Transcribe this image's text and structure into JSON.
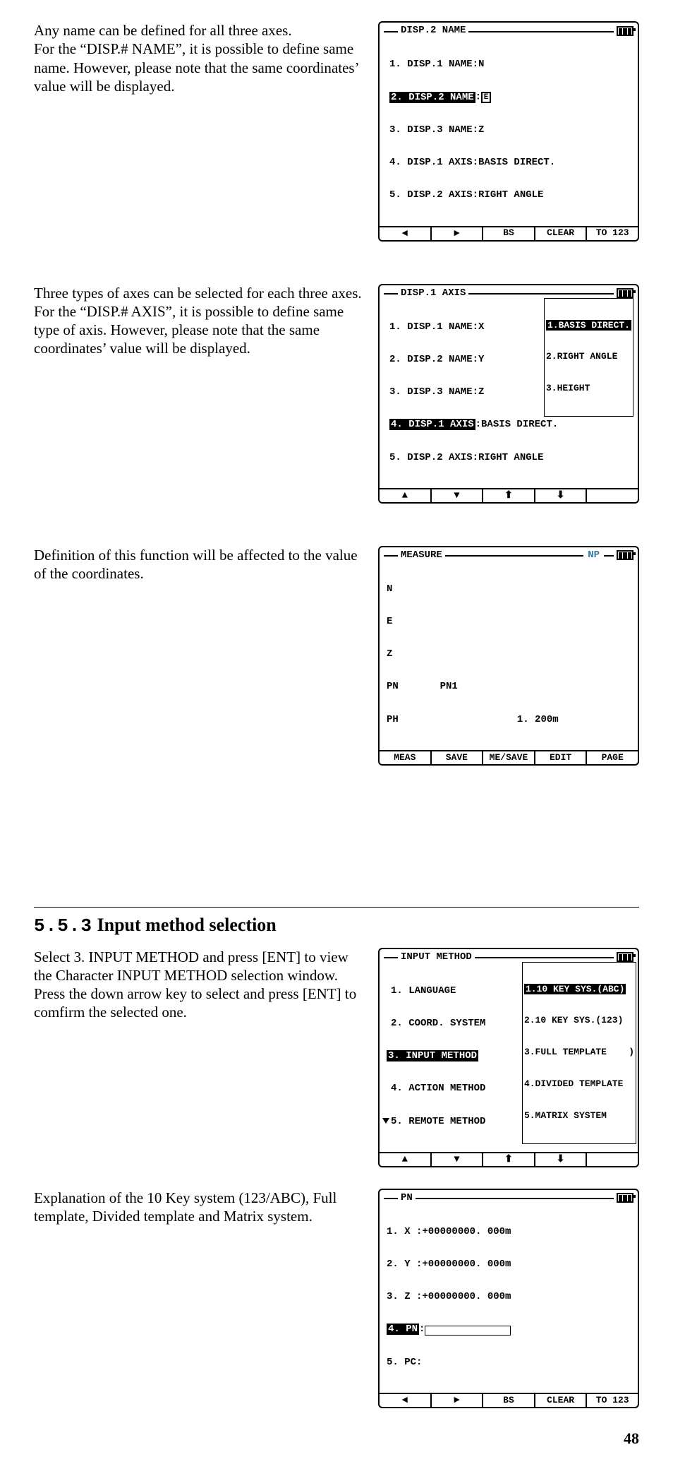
{
  "para1": "Any name can be defined for all three axes.\nFor the “DISP.# NAME”, it is possible to define same name. However, please note that the same coordinates’ value will be displayed.",
  "para2": "Three types of axes can be selected for each three axes.\nFor the “DISP.# AXIS”, it is possible to define same type of axis. However, please note that the same coordinates’ value will be displayed.",
  "para3": "Definition of this function will be affected to the value of the coordinates.",
  "section_number": "5.5.3",
  "section_title": "Input method selection",
  "para4": "Select 3. INPUT METHOD and press [ENT] to view the Character INPUT METHOD selection window. Press the down arrow key to select and press [ENT] to comfirm the selected one.",
  "para5": "Explanation of the 10 Key system (123/ABC), Full template, Divided template and Matrix system.",
  "page_number": "48",
  "lcd1": {
    "title": "DISP.2 NAME",
    "l1": "1. DISP.1 NAME:N",
    "l2a": "2. DISP.2 NAME",
    "l2b": "E",
    "l3": "3. DISP.3 NAME:Z",
    "l4": "4. DISP.1 AXIS:BASIS DIRECT.",
    "l5": "5. DISP.2 AXIS:RIGHT ANGLE",
    "sk3": "BS",
    "sk4": "CLEAR",
    "sk5": "TO 123"
  },
  "lcd2": {
    "title": "DISP.1 AXIS",
    "l1": "1. DISP.1 NAME:X",
    "l2": "2. DISP.2 NAME:Y",
    "l3": "3. DISP.3 NAME:Z",
    "l4a": "4. DISP.1 AXIS",
    "l4b": ":BASIS DIRECT.",
    "l5": "5. DISP.2 AXIS:RIGHT ANGLE",
    "m1": "1.BASIS DIRECT.",
    "m2": "2.RIGHT ANGLE",
    "m3": "3.HEIGHT"
  },
  "lcd3": {
    "title": "MEASURE",
    "np": "NP",
    "c1": "N",
    "c2": "E",
    "c3": "Z",
    "pn": "PN",
    "pn_val": "PN1",
    "ph": "PH",
    "ph_val": "1. 200m",
    "sk1": "MEAS",
    "sk2": "SAVE",
    "sk3": "ME/SAVE",
    "sk4": "EDIT",
    "sk5": "PAGE"
  },
  "lcd4": {
    "title": "INPUT METHOD",
    "l1": "1. LANGUAGE",
    "l2": "2. COORD. SYSTEM",
    "l3": "3. INPUT METHOD",
    "l4": "4. ACTION METHOD",
    "l5": "5. REMOTE METHOD",
    "m1": "1.10 KEY SYS.(ABC)",
    "m2": "2.10 KEY SYS.(123)",
    "m3": "3.FULL TEMPLATE",
    "m4": "4.DIVIDED TEMPLATE",
    "m5": "5.MATRIX SYSTEM"
  },
  "lcd5": {
    "title": "PN",
    "l1": "1. X :+00000000. 000m",
    "l2": "2. Y :+00000000. 000m",
    "l3": "3. Z :+00000000. 000m",
    "l4": "4. PN",
    "l5": "5. PC:",
    "sk3": "BS",
    "sk4": "CLEAR",
    "sk5": "TO 123"
  }
}
